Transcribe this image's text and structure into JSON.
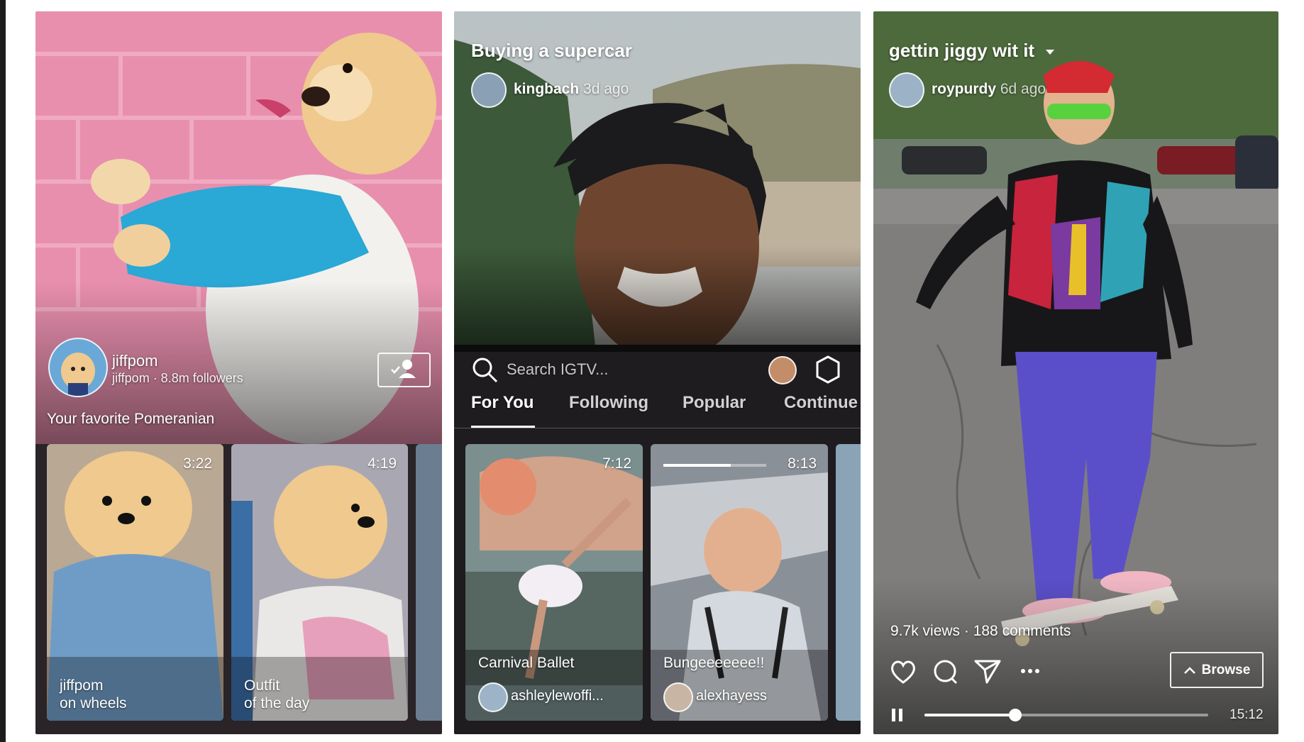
{
  "panel_profile": {
    "channel_name": "jiffpom",
    "channel_sub": "jiffpom · 8.8m followers",
    "description": "Your favorite Pomeranian",
    "follow_icon": "person-check-icon",
    "tiles": [
      {
        "duration": "3:22",
        "label": "jiffpom\non wheels"
      },
      {
        "duration": "4:19",
        "label": "Outfit\nof the day"
      }
    ]
  },
  "panel_browse": {
    "title": "Buying a supercar",
    "author": "kingbach",
    "age": "3d ago",
    "search_placeholder": "Search IGTV...",
    "settings_icon": "gear-icon",
    "tabs": [
      "For You",
      "Following",
      "Popular",
      "Continue"
    ],
    "active_tab": "For You",
    "tiles": [
      {
        "duration": "7:12",
        "title": "Carnival Ballet",
        "author": "ashleylewoffi..."
      },
      {
        "duration": "8:13",
        "title": "Bungeeeeeee!!",
        "author": "alexhayess"
      }
    ]
  },
  "panel_player": {
    "title": "gettin jiggy wit it",
    "author": "roypurdy",
    "age": "6d ago",
    "stats": "9.7k views · 188 comments",
    "browse_label": "Browse",
    "time": "15:12",
    "progress": 0.32,
    "icons": [
      "heart-icon",
      "comment-icon",
      "send-icon",
      "more-icon",
      "pause-icon",
      "chevron-down-icon"
    ]
  },
  "colors": {
    "pink_wall": "#e88fae",
    "tab_underline": "#ffffff",
    "progress": "#ffffff"
  }
}
